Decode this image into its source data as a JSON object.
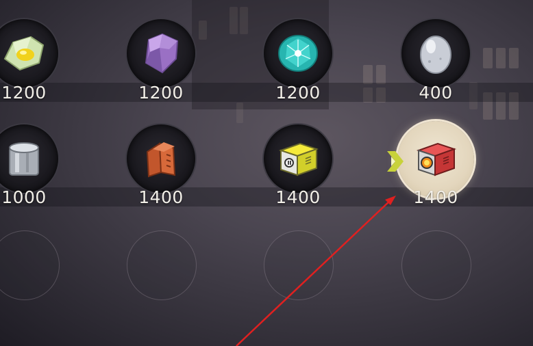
{
  "items": [
    {
      "name": "yellow-crystal-ore",
      "price": "1200"
    },
    {
      "name": "purple-crystal",
      "price": "1200"
    },
    {
      "name": "teal-gem",
      "price": "1200"
    },
    {
      "name": "silver-egg",
      "price": "400"
    },
    {
      "name": "silver-ingot",
      "price": "1000"
    },
    {
      "name": "copper-plates",
      "price": "1400"
    },
    {
      "name": "yellow-box",
      "price": "1400"
    },
    {
      "name": "red-furnace-box",
      "price": "1400",
      "selected": true
    }
  ],
  "colors": {
    "price_text": "#f2efe8",
    "selected_bg": "#e3d6bd",
    "marker": "#c8d23a",
    "annotation_arrow": "#e02020"
  }
}
